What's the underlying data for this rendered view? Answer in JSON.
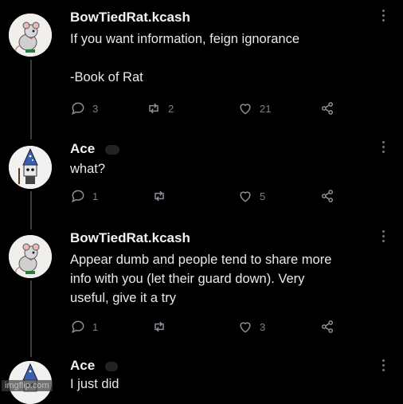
{
  "tweets": [
    {
      "author": "BowTiedRat.kcash",
      "lines": [
        "If you want information, feign ignorance",
        "",
        "-Book of Rat"
      ],
      "avatar": "rat-avatar",
      "replies": "3",
      "retweets": "2",
      "likes": "21"
    },
    {
      "author": "Ace",
      "lines": [
        "what?"
      ],
      "avatar": "wizard-avatar",
      "replies": "1",
      "retweets": "",
      "likes": "5"
    },
    {
      "author": "BowTiedRat.kcash",
      "lines": [
        "Appear dumb and people tend to share more",
        "info with you (let their guard down). Very",
        "useful, give it a try"
      ],
      "avatar": "rat-avatar",
      "replies": "1",
      "retweets": "",
      "likes": "3"
    },
    {
      "author": "Ace",
      "lines": [
        "I just did"
      ],
      "avatar": "wizard-avatar"
    }
  ],
  "watermark": "imgflip.com",
  "colors": {
    "background": "#000000",
    "text": "#e7e9ea",
    "muted": "#7a8086",
    "thread_line": "#3a3d40"
  }
}
